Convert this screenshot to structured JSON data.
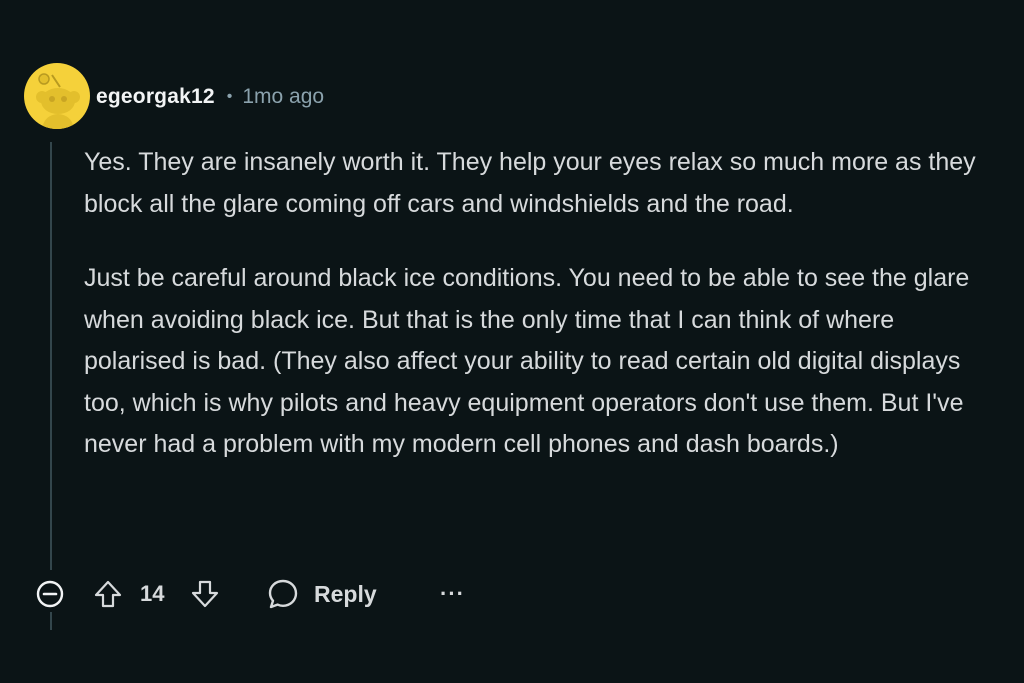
{
  "comment": {
    "avatar": {
      "icon": "reddit-snoo-icon",
      "color": "#f5d13a"
    },
    "username": "egeorgak12",
    "separator": "•",
    "timestamp": "1mo ago",
    "paragraphs": [
      "Yes. They are insanely worth it. They help your eyes relax so much more as they block all the glare coming off cars and windshields and the road.",
      "Just be careful around black ice conditions. You need to be able to see the glare when avoiding black ice. But that is the only time that I can think of where polarised is bad. (They also affect your ability to read certain old digital displays too, which is why pilots and heavy equipment operators don't use them. But I've never had a problem with my modern cell phones and dash boards.)"
    ]
  },
  "actions": {
    "collapse_icon": "collapse-minus-icon",
    "upvote_icon": "upvote-arrow-icon",
    "score": "14",
    "downvote_icon": "downvote-arrow-icon",
    "reply_icon": "speech-bubble-icon",
    "reply_label": "Reply",
    "more_label": "···"
  },
  "colors": {
    "background": "#0b1416",
    "text": "#d7dadc",
    "meta": "#8ba2ad",
    "thread_line": "#33464c"
  }
}
